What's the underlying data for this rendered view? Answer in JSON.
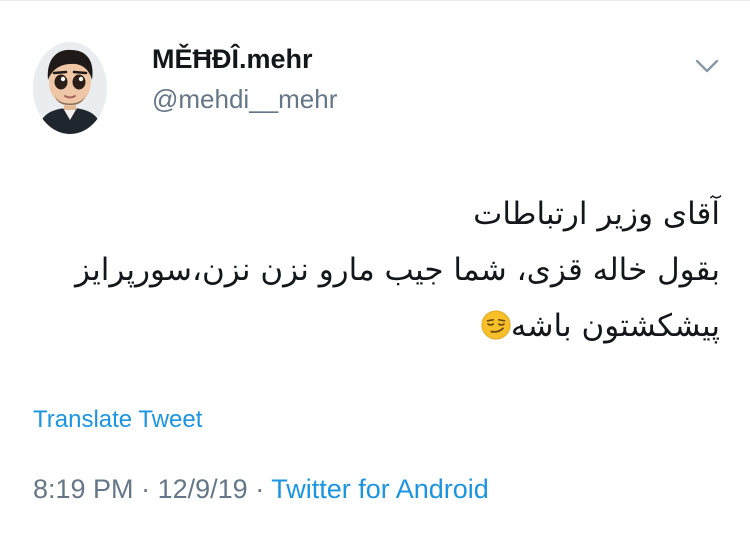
{
  "tweet": {
    "display_name": "MĚĦÐÎ.mehr",
    "handle": "@mehdi__mehr",
    "text_lines": [
      "آقای وزیر ارتباطات",
      "بقول خاله قزی، شما جیب مارو نزن نزن،سورپرایز",
      "پیشکشتون باشه"
    ],
    "emoji": "smirking-face",
    "translate_label": "Translate Tweet",
    "time": "8:19 PM",
    "date": "12/9/19",
    "separator": "·",
    "source": "Twitter for Android"
  },
  "icons": {
    "more": "chevron-down-icon",
    "avatar": "cartoon-avatar"
  },
  "colors": {
    "text": "#14171a",
    "secondary": "#657786",
    "link": "#1b95e0"
  }
}
